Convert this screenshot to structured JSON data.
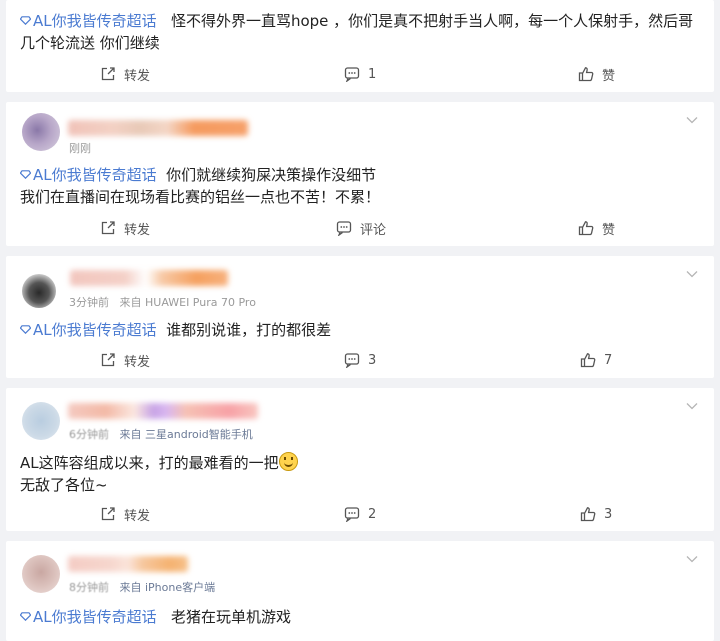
{
  "topic": {
    "label": "AL你我皆传奇超话"
  },
  "actions": {
    "repost": "转发",
    "comment": "评论",
    "like": "赞"
  },
  "posts": [
    {
      "line1": "怪不得外界一直骂hope ，你们是真不把射手当人啊，每一个人保射手，然后哥",
      "line2": "几个轮流送 你们继续",
      "comment_count": "1",
      "like_label": "赞"
    },
    {
      "time": "刚刚",
      "line1": "你们就继续狗屎决策操作没细节",
      "line2": "我们在直播间在现场看比赛的铝丝一点也不苦！不累！",
      "comment_label": "评论",
      "like_label": "赞"
    },
    {
      "time": "3分钟前",
      "source": "来自 HUAWEI Pura 70 Pro",
      "line1": "谁都别说谁，打的都很差",
      "comment_count": "3",
      "like_count": "7"
    },
    {
      "time": "6分钟前",
      "source": "来自 三星android智能手机",
      "line1": "AL这阵容组成以来，打的最难看的一把",
      "line2": "无敌了各位~",
      "comment_count": "2",
      "like_count": "3",
      "emoji_icon": "grinning-face-emoji"
    },
    {
      "time": "8分钟前",
      "source": "来自 iPhone客户端",
      "line1": "老猪在玩单机游戏"
    }
  ],
  "colors": {
    "topic": "#4b7bd1",
    "background": "#f1f2f5",
    "card": "#ffffff"
  }
}
